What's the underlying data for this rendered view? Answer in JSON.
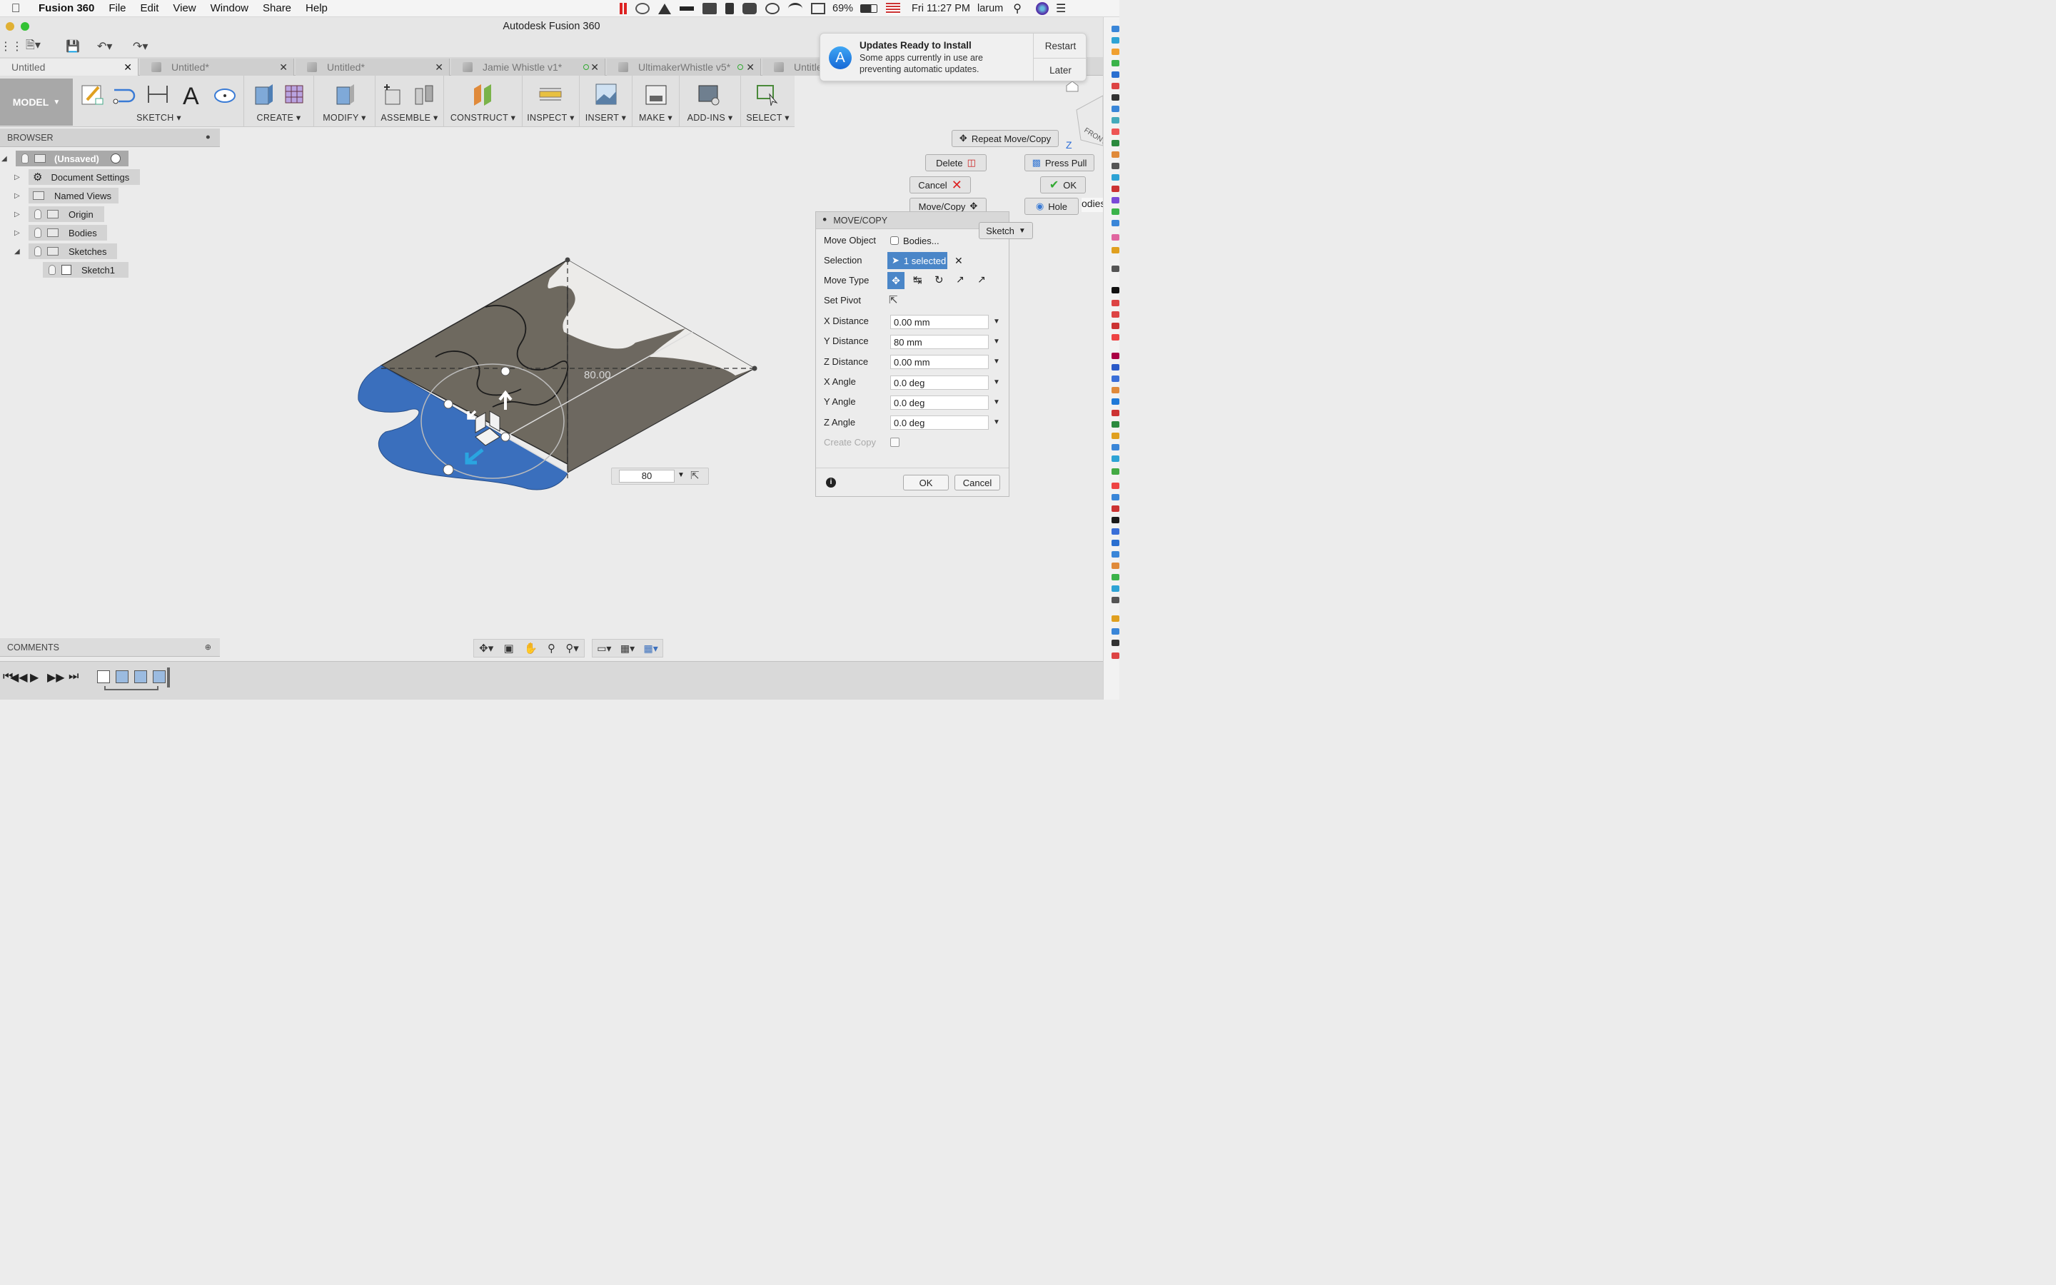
{
  "menubar": {
    "app_name": "Fusion 360",
    "menus": [
      "File",
      "Edit",
      "View",
      "Window",
      "Share",
      "Help"
    ],
    "battery": "69%",
    "clock": "Fri 11:27 PM",
    "user": "larum"
  },
  "window": {
    "title": "Autodesk Fusion 360"
  },
  "tabs": [
    {
      "label": "Untitled"
    },
    {
      "label": "Untitled*"
    },
    {
      "label": "Untitled*"
    },
    {
      "label": "Jamie Whistle v1*"
    },
    {
      "label": "UltimakerWhistle v5*"
    },
    {
      "label": "Untitle"
    }
  ],
  "ribbon": {
    "workspace": "MODEL",
    "groups": [
      "SKETCH",
      "CREATE",
      "MODIFY",
      "ASSEMBLE",
      "CONSTRUCT",
      "INSPECT",
      "INSERT",
      "MAKE",
      "ADD-INS",
      "SELECT"
    ]
  },
  "browser": {
    "header": "BROWSER",
    "root": "(Unsaved)",
    "items": [
      "Document Settings",
      "Named Views",
      "Origin",
      "Bodies",
      "Sketches",
      "Sketch1"
    ]
  },
  "comments": {
    "header": "COMMENTS"
  },
  "notification": {
    "title": "Updates Ready to Install",
    "body_line1": "Some apps currently in use are",
    "body_line2": "preventing automatic updates.",
    "restart": "Restart",
    "later": "Later"
  },
  "marking_menu": {
    "repeat": "Repeat Move/Copy",
    "delete": "Delete",
    "press_pull": "Press Pull",
    "cancel": "Cancel",
    "ok": "OK",
    "move_copy": "Move/Copy",
    "hole": "Hole",
    "sketch": "Sketch",
    "bodies_partial": "odies"
  },
  "dialog": {
    "title": "MOVE/COPY",
    "labels": {
      "move_object": "Move Object",
      "selection": "Selection",
      "move_type": "Move Type",
      "set_pivot": "Set Pivot",
      "x_distance": "X Distance",
      "y_distance": "Y Distance",
      "z_distance": "Z Distance",
      "x_angle": "X Angle",
      "y_angle": "Y Angle",
      "z_angle": "Z Angle",
      "create_copy": "Create Copy"
    },
    "values": {
      "move_object": "Bodies...",
      "selection": "1 selected",
      "x_distance": "0.00 mm",
      "y_distance": "80 mm",
      "z_distance": "0.00 mm",
      "x_angle": "0.0 deg",
      "y_angle": "0.0 deg",
      "z_angle": "0.0 deg"
    },
    "ok": "OK",
    "cancel": "Cancel"
  },
  "viewport": {
    "dimension_label": "80.00",
    "input_value": "80",
    "viewcube_label": "FRONT",
    "axis_label": "Z"
  },
  "colors": {
    "selected_body": "#3a6fbd",
    "body_top": "#6f6a61",
    "accent": "#4a86c8"
  }
}
